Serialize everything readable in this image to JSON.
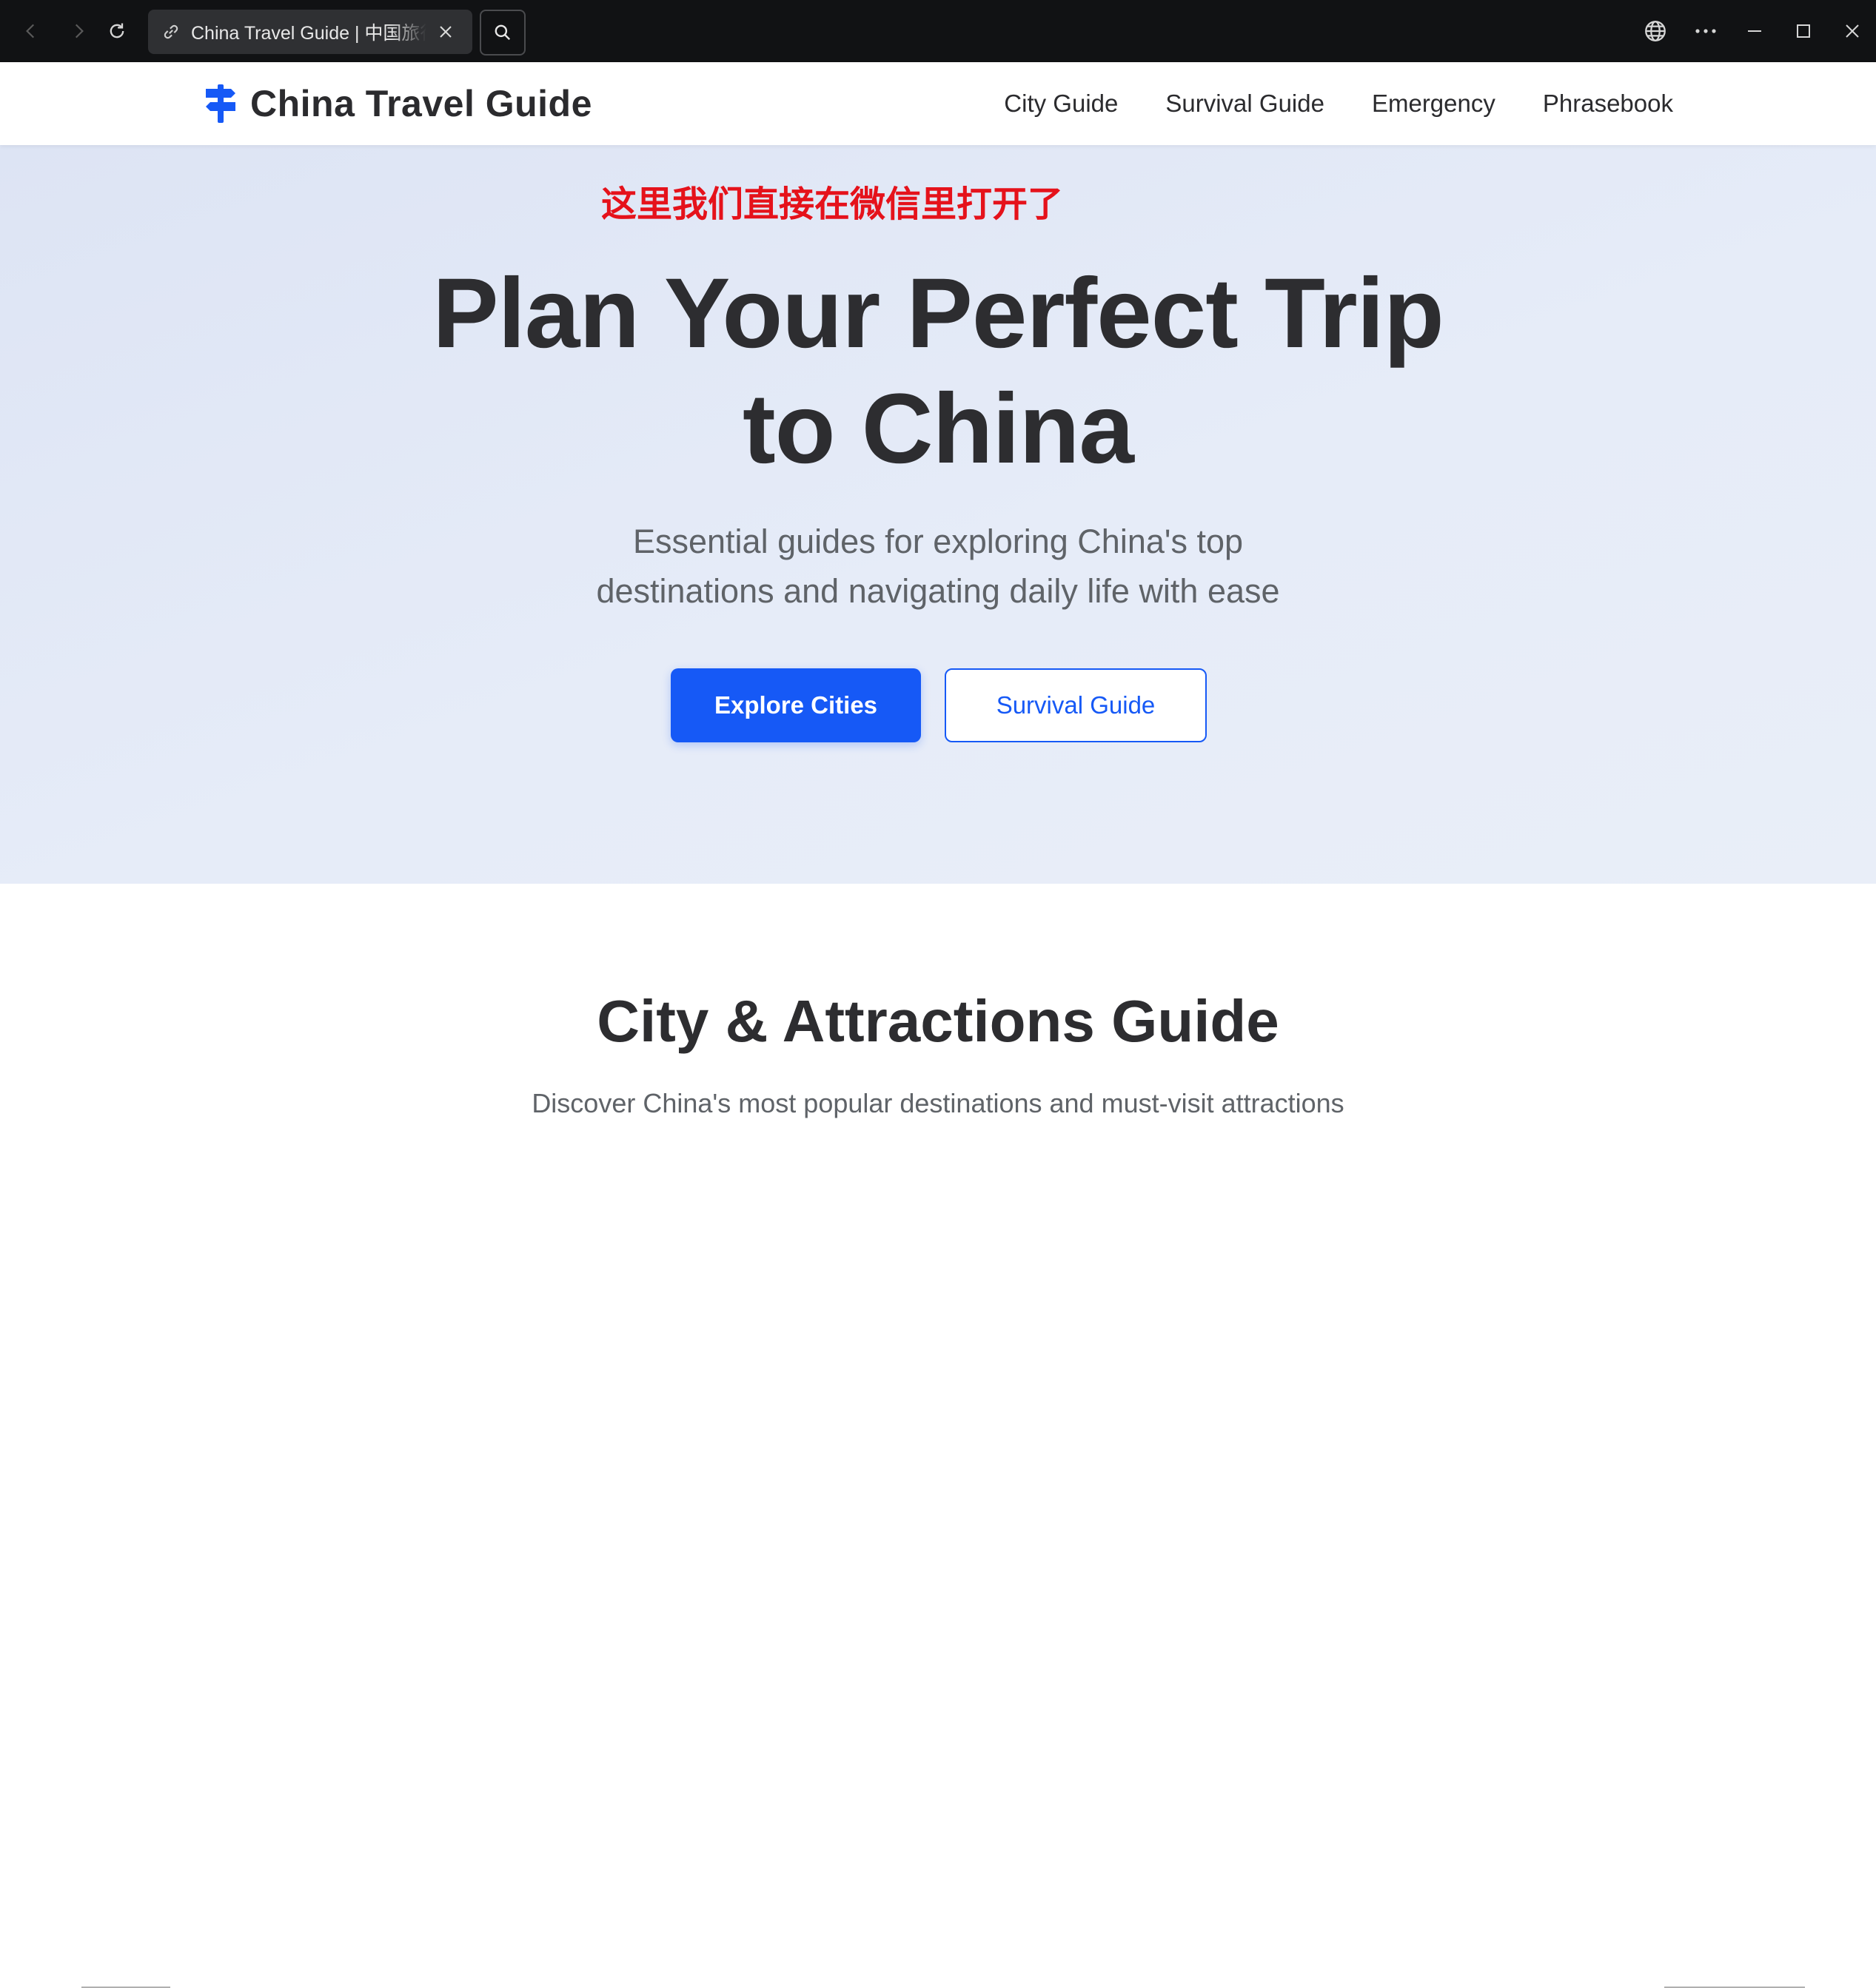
{
  "browser": {
    "tab_title": "China Travel Guide | 中国旅行指南",
    "icons": {
      "back": "back-arrow-icon",
      "forward": "forward-arrow-icon",
      "reload": "reload-icon",
      "tab_link": "link-icon",
      "tab_close": "close-icon",
      "search": "search-icon",
      "language": "globe-icon",
      "more": "more-horizontal-icon",
      "minimize": "minimize-icon",
      "maximize": "maximize-icon",
      "close_window": "window-close-icon"
    }
  },
  "header": {
    "logo_text": "China Travel Guide",
    "logo_icon": "signpost-icon",
    "nav": [
      "City Guide",
      "Survival Guide",
      "Emergency",
      "Phrasebook"
    ]
  },
  "hero": {
    "annotation": "这里我们直接在微信里打开了",
    "title_line1": "Plan Your Perfect Trip",
    "title_line2": "to China",
    "subtitle_line1": "Essential guides for exploring China's top",
    "subtitle_line2": "destinations and navigating daily life with ease",
    "primary_button": "Explore Cities",
    "secondary_button": "Survival Guide"
  },
  "section": {
    "title": "City & Attractions Guide",
    "subtitle": "Discover China's most popular destinations and must-visit attractions"
  },
  "colors": {
    "accent": "#1659f6",
    "annotation": "#e5121b",
    "chrome_bg": "#111214",
    "hero_bg": "#e3e9f6",
    "heading": "#2d2d30"
  }
}
